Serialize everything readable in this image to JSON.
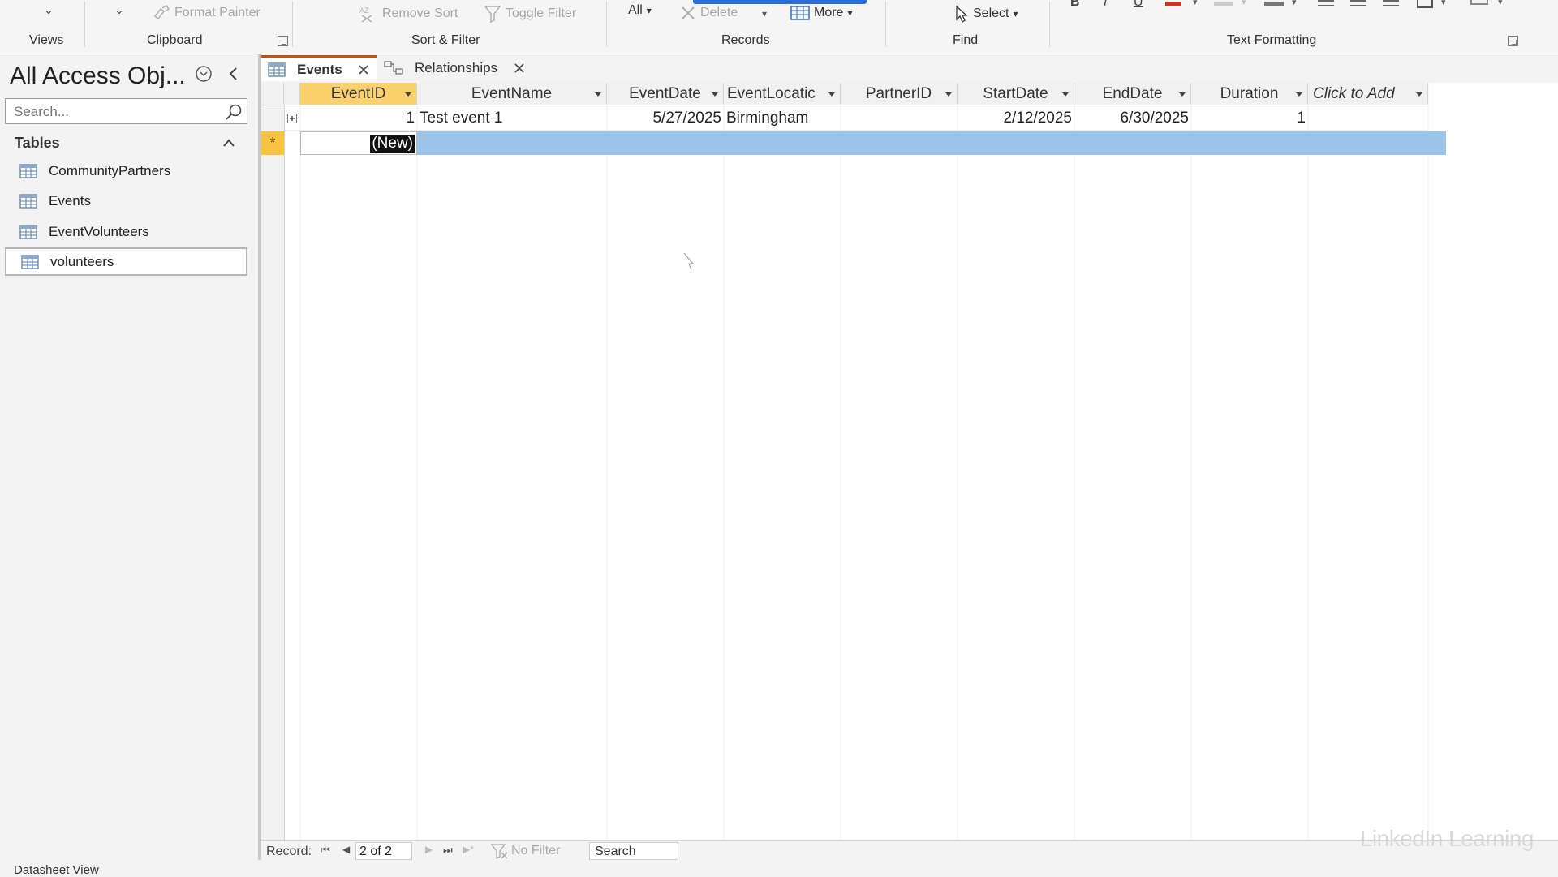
{
  "ribbon": {
    "groups": {
      "views": "Views",
      "clipboard": "Clipboard",
      "sort_filter": "Sort & Filter",
      "records": "Records",
      "find": "Find",
      "text_formatting": "Text Formatting"
    },
    "buttons": {
      "format_painter": "Format Painter",
      "remove_sort": "Remove Sort",
      "toggle_filter": "Toggle Filter",
      "refresh_all": "All",
      "delete": "Delete",
      "more": "More",
      "select": "Select"
    },
    "format_labels": {
      "bold": "B",
      "italic": "I",
      "underline": "U"
    }
  },
  "nav": {
    "title": "All Access Obj...",
    "search_placeholder": "Search...",
    "section": "Tables",
    "items": [
      {
        "label": "CommunityPartners"
      },
      {
        "label": "Events"
      },
      {
        "label": "EventVolunteers"
      },
      {
        "label": "volunteers"
      }
    ]
  },
  "tabs": [
    {
      "label": "Events"
    },
    {
      "label": "Relationships"
    }
  ],
  "table": {
    "columns": [
      "EventID",
      "EventName",
      "EventDate",
      "EventLocatic",
      "PartnerID",
      "StartDate",
      "EndDate",
      "Duration",
      "Click to Add"
    ],
    "rows": [
      {
        "EventID": "1",
        "EventName": "Test event 1",
        "EventDate": "5/27/2025",
        "EventLocation": "Birmingham",
        "PartnerID": "",
        "StartDate": "2/12/2025",
        "EndDate": "6/30/2025",
        "Duration": "1"
      }
    ],
    "new_row_marker": "*",
    "new_row_label": "(New)",
    "expand_symbol": "+"
  },
  "record_nav": {
    "label": "Record:",
    "position": "2 of 2",
    "filter": "No Filter",
    "search": "Search"
  },
  "status": {
    "view": "Datasheet View"
  },
  "watermark": "LinkedIn Learning",
  "colors": {
    "selected_header": "#fbd16e",
    "new_row_highlight": "#9cc3ea",
    "new_record_marker": "#f7c340",
    "tab_accent": "#c2540a"
  }
}
